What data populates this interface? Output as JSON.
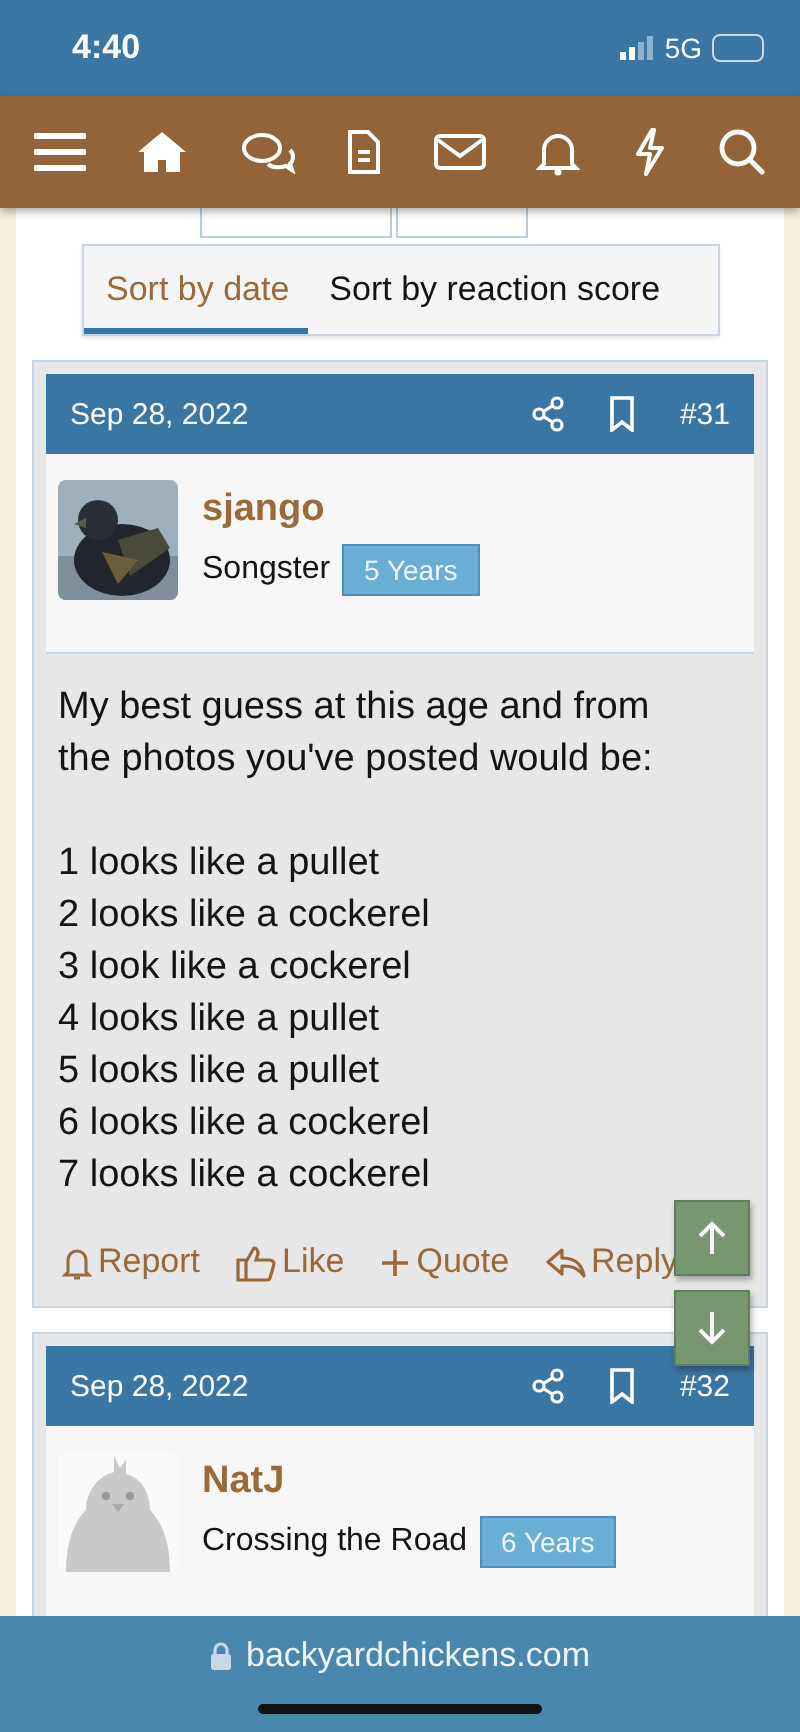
{
  "status_bar": {
    "time": "4:40",
    "network": "5G"
  },
  "sort_tabs": [
    {
      "label": "Sort by date",
      "selected": true
    },
    {
      "label": "Sort by reaction score",
      "selected": false
    }
  ],
  "posts": [
    {
      "date": "Sep 28, 2022",
      "number": "#31",
      "username": "sjango",
      "title": "Songster",
      "badge": "5 Years",
      "message": {
        "intro": "My best guess at this age and from the photos you've posted would be:",
        "lines": [
          "1 looks like a pullet",
          "2 looks like a cockerel",
          "3 look like a cockerel",
          "4 looks like a pullet",
          "5 looks like a pullet",
          "6 looks like a cockerel",
          "7 looks like a cockerel"
        ]
      },
      "actions": [
        "Report",
        "Like",
        "Quote",
        "Reply"
      ]
    },
    {
      "date": "Sep 28, 2022",
      "number": "#32",
      "username": "NatJ",
      "title": "Crossing the Road",
      "badge": "6 Years",
      "avatar": {
        "kind": "default"
      }
    }
  ],
  "url_bar": {
    "domain": "backyardchickens.com"
  }
}
